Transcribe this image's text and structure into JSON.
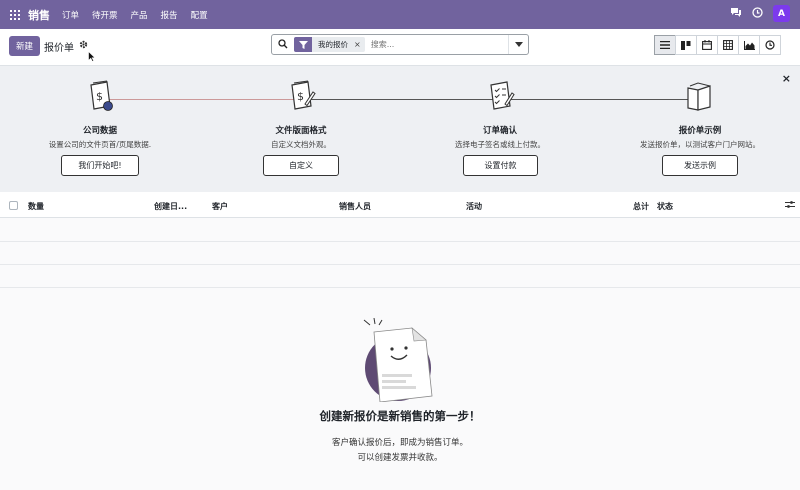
{
  "navbar": {
    "brand": "销售",
    "menu": [
      "订单",
      "待开票",
      "产品",
      "报告",
      "配置"
    ],
    "avatar_letter": "A",
    "color": "#71639e"
  },
  "control_panel": {
    "new_button": "新建",
    "title": "报价单",
    "search": {
      "facet_label": "我的报价",
      "placeholder": "搜索..."
    },
    "views": [
      "list",
      "kanban",
      "calendar",
      "pivot",
      "graph",
      "activity"
    ],
    "active_view": "list"
  },
  "helper": {
    "close": "×",
    "steps": [
      {
        "title": "公司数据",
        "desc": "设置公司的文件页首/页尾数据.",
        "button": "我们开始吧!"
      },
      {
        "title": "文件版面格式",
        "desc": "自定义文档外观。",
        "button": "自定义"
      },
      {
        "title": "订单确认",
        "desc": "选择电子签名或线上付款。",
        "button": "设置付款"
      },
      {
        "title": "报价单示例",
        "desc": "发送报价单，以测试客户门户网站。",
        "button": "发送示例"
      }
    ]
  },
  "list": {
    "columns": [
      "数量",
      "创建日...",
      "客户",
      "销售人员",
      "活动",
      "总计",
      "状态"
    ]
  },
  "empty_state": {
    "title": "创建新报价是新销售的第一步！",
    "line1": "客户确认报价后，即成为销售订单。",
    "line2": "可以创建发票并收款。"
  }
}
